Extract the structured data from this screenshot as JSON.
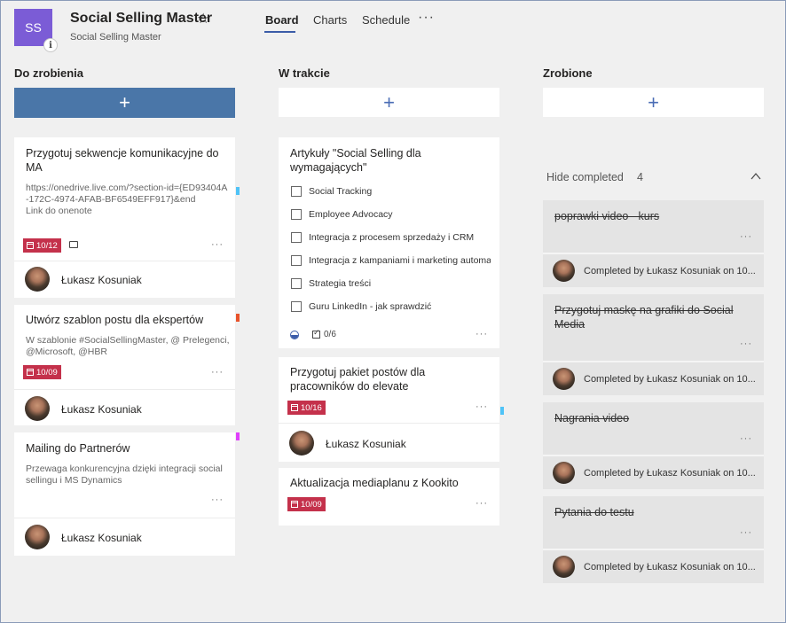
{
  "header": {
    "avatar_initials": "SS",
    "info_glyph": "i",
    "title": "Social Selling Master",
    "subtitle": "Social Selling Master",
    "tabs": [
      {
        "label": "Board",
        "active": true
      },
      {
        "label": "Charts",
        "active": false
      },
      {
        "label": "Schedule",
        "active": false
      }
    ],
    "more_glyph": "···",
    "accent_color": "#7b5cd6"
  },
  "columns": {
    "todo": {
      "title": "Do zrobienia",
      "add_glyph": "+"
    },
    "inprogress": {
      "title": "W trakcie",
      "add_glyph": "+"
    },
    "done": {
      "title": "Zrobione",
      "add_glyph": "+"
    }
  },
  "todo_cards": [
    {
      "title": "Przygotuj sekwencje komunikacyjne do MA",
      "desc": "https://onedrive.live.com/?section-id={ED93404A-172C-4974-AFAB-BF6549EFF917}&end\nLink do onenote",
      "date": "10/12",
      "assignee": "Łukasz Kosuniak",
      "label_color": "#4fc3f7"
    },
    {
      "title": "Utwórz szablon postu dla ekspertów",
      "desc": "W szablonie #SocialSellingMaster, @ Prelegenci, @Microsoft, @HBR",
      "date": "10/09",
      "assignee": "Łukasz Kosuniak",
      "label_color": "#e8532b"
    },
    {
      "title": "Mailing do Partnerów",
      "desc": "Przewaga konkurencyjna dzięki integracji social sellingu i MS Dynamics",
      "assignee": "Łukasz Kosuniak",
      "label_color": "#e040fb"
    }
  ],
  "inprogress_cards": [
    {
      "title": "Artykuły \"Social Selling dla wymagających\"",
      "checklist": [
        "Social Tracking",
        "Employee Advocacy",
        "Integracja z procesem sprzedaży i CRM",
        "Integracja z kampaniami i marketing automa",
        "Strategia treści",
        "Guru LinkedIn - jak sprawdzić"
      ],
      "checklist_count": "0/6"
    },
    {
      "title": "Przygotuj pakiet postów dla pracowników do elevate",
      "date": "10/16",
      "assignee": "Łukasz Kosuniak",
      "label_color": "#4fc3f7"
    },
    {
      "title": "Aktualizacja mediaplanu z Kookito",
      "date": "10/09"
    }
  ],
  "done_section": {
    "toggle_label": "Hide completed",
    "count": "4",
    "cards": [
      {
        "title": "poprawki video - kurs",
        "completed": "Completed by Łukasz Kosuniak on 10..."
      },
      {
        "title": "Przygotuj maskę na grafiki do Social Media",
        "completed": "Completed by Łukasz Kosuniak on 10..."
      },
      {
        "title": "Nagrania video",
        "completed": "Completed by Łukasz Kosuniak on 10..."
      },
      {
        "title": "Pytania do testu",
        "completed": "Completed by Łukasz Kosuniak on 10..."
      }
    ]
  },
  "icons": {
    "star": "star-outline-icon",
    "more": "more-horizontal-icon",
    "calendar": "calendar-icon",
    "comment": "comment-icon",
    "progress": "progress-half-icon",
    "checklist": "checklist-icon",
    "chevron": "chevron-up-icon"
  },
  "more_dots": "···"
}
